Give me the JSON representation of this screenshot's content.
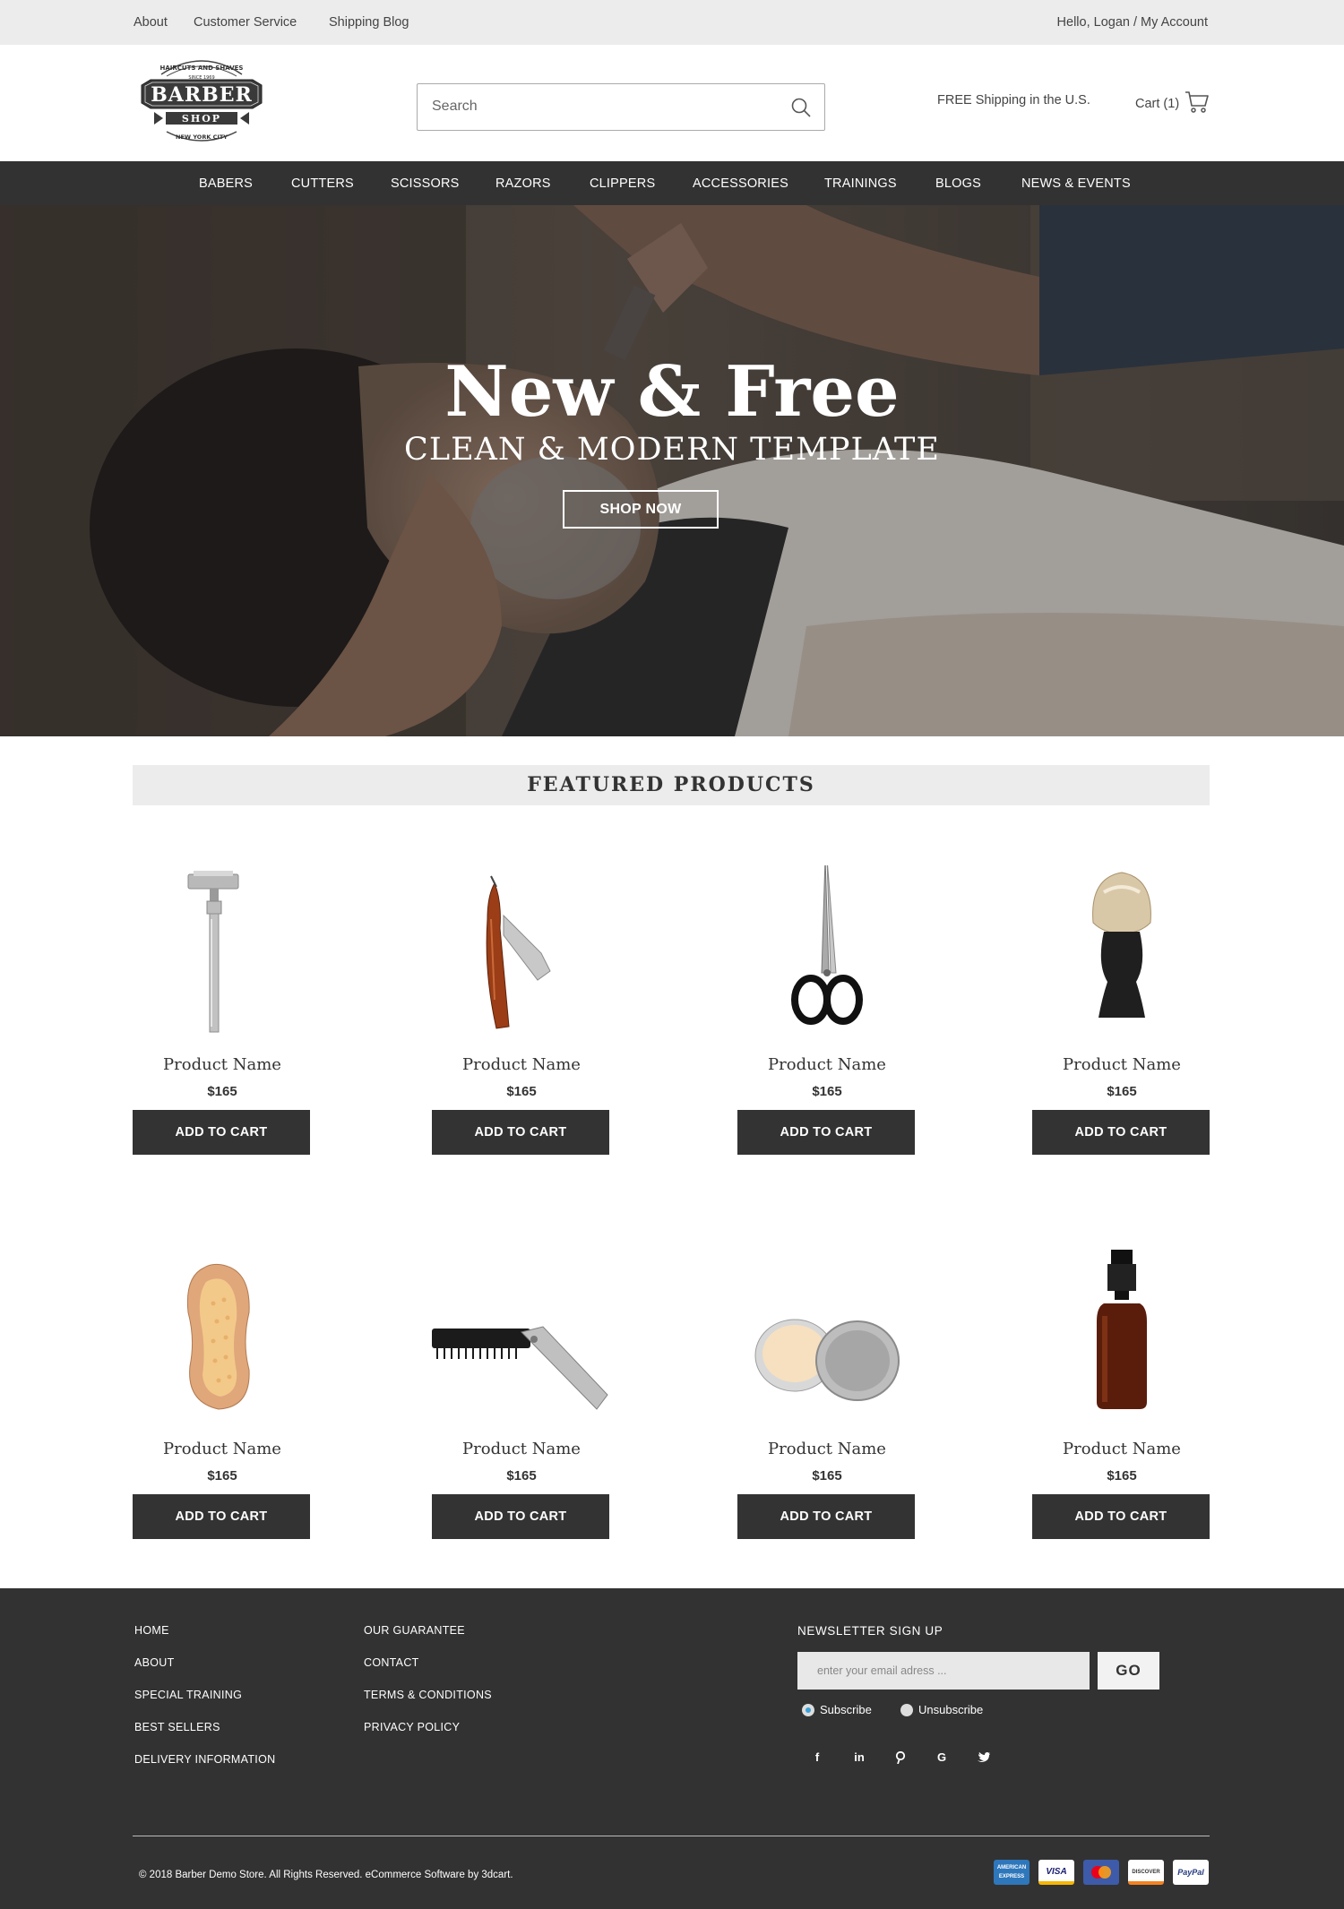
{
  "topbar": {
    "links": [
      "About",
      "Customer Service",
      "Shipping Blog"
    ],
    "account": "Hello, Logan / My Account"
  },
  "header": {
    "logo": {
      "top_text": "HAIRCUTS AND SHAVES",
      "since": "SINCE 1969",
      "main": "BARBER",
      "sub": "SHOP",
      "city": "NEW YORK CITY"
    },
    "search_placeholder": "Search",
    "shipping_text": "FREE Shipping in the U.S.",
    "cart_label": "Cart (1)"
  },
  "nav": {
    "items": [
      "BABERS",
      "CUTTERS",
      "SCISSORS",
      "RAZORS",
      "CLIPPERS",
      "ACCESSORIES",
      "TRAININGS",
      "BLOGS",
      "NEWS & EVENTS"
    ]
  },
  "hero": {
    "title": "New & Free",
    "subtitle": "CLEAN & MODERN TEMPLATE",
    "button": "SHOP NOW"
  },
  "featured": {
    "heading": "FEATURED  PRODUCTS",
    "products": [
      {
        "name": "Product Name",
        "price": "$165",
        "button": "ADD TO CART",
        "image": "safety-razor"
      },
      {
        "name": "Product Name",
        "price": "$165",
        "button": "ADD TO CART",
        "image": "straight-razor"
      },
      {
        "name": "Product Name",
        "price": "$165",
        "button": "ADD TO CART",
        "image": "scissors"
      },
      {
        "name": "Product Name",
        "price": "$165",
        "button": "ADD TO CART",
        "image": "shaving-brush"
      },
      {
        "name": "Product Name",
        "price": "$165",
        "button": "ADD TO CART",
        "image": "beard-brush"
      },
      {
        "name": "Product Name",
        "price": "$165",
        "button": "ADD TO CART",
        "image": "folding-comb"
      },
      {
        "name": "Product Name",
        "price": "$165",
        "button": "ADD TO CART",
        "image": "pomade-tin"
      },
      {
        "name": "Product Name",
        "price": "$165",
        "button": "ADD TO CART",
        "image": "spray-bottle"
      }
    ]
  },
  "footer": {
    "col1": [
      "HOME",
      "ABOUT",
      "SPECIAL TRAINING",
      "BEST SELLERS",
      "DELIVERY INFORMATION"
    ],
    "col2": [
      "OUR GUARANTEE",
      "CONTACT",
      "TERMS & CONDITIONS",
      "PRIVACY POLICY"
    ],
    "newsletter": {
      "title": "NEWSLETTER SIGN UP",
      "placeholder": "enter your email adress ...",
      "button": "GO",
      "subscribe": "Subscribe",
      "unsubscribe": "Unsubscribe",
      "selected": "Subscribe"
    },
    "social": [
      "facebook-icon",
      "linkedin-icon",
      "pinterest-icon",
      "google-icon",
      "twitter-icon"
    ],
    "copyright": "© 2018 Barber Demo Store. All Rights Reserved. eCommerce Software by 3dcart.",
    "payment_cards": [
      {
        "label": "AMERICAN EXPRESS",
        "color": "#2e77bb"
      },
      {
        "label": "VISA",
        "color": "#ffffff"
      },
      {
        "label": "mastercard",
        "color": "#3d5ba9"
      },
      {
        "label": "DISCOVER",
        "color": "#ffffff"
      },
      {
        "label": "PayPal",
        "color": "#ffffff"
      }
    ]
  },
  "colors": {
    "dark": "#323232",
    "topbar_bg": "#ececec",
    "accent": "#3aa0d8"
  }
}
